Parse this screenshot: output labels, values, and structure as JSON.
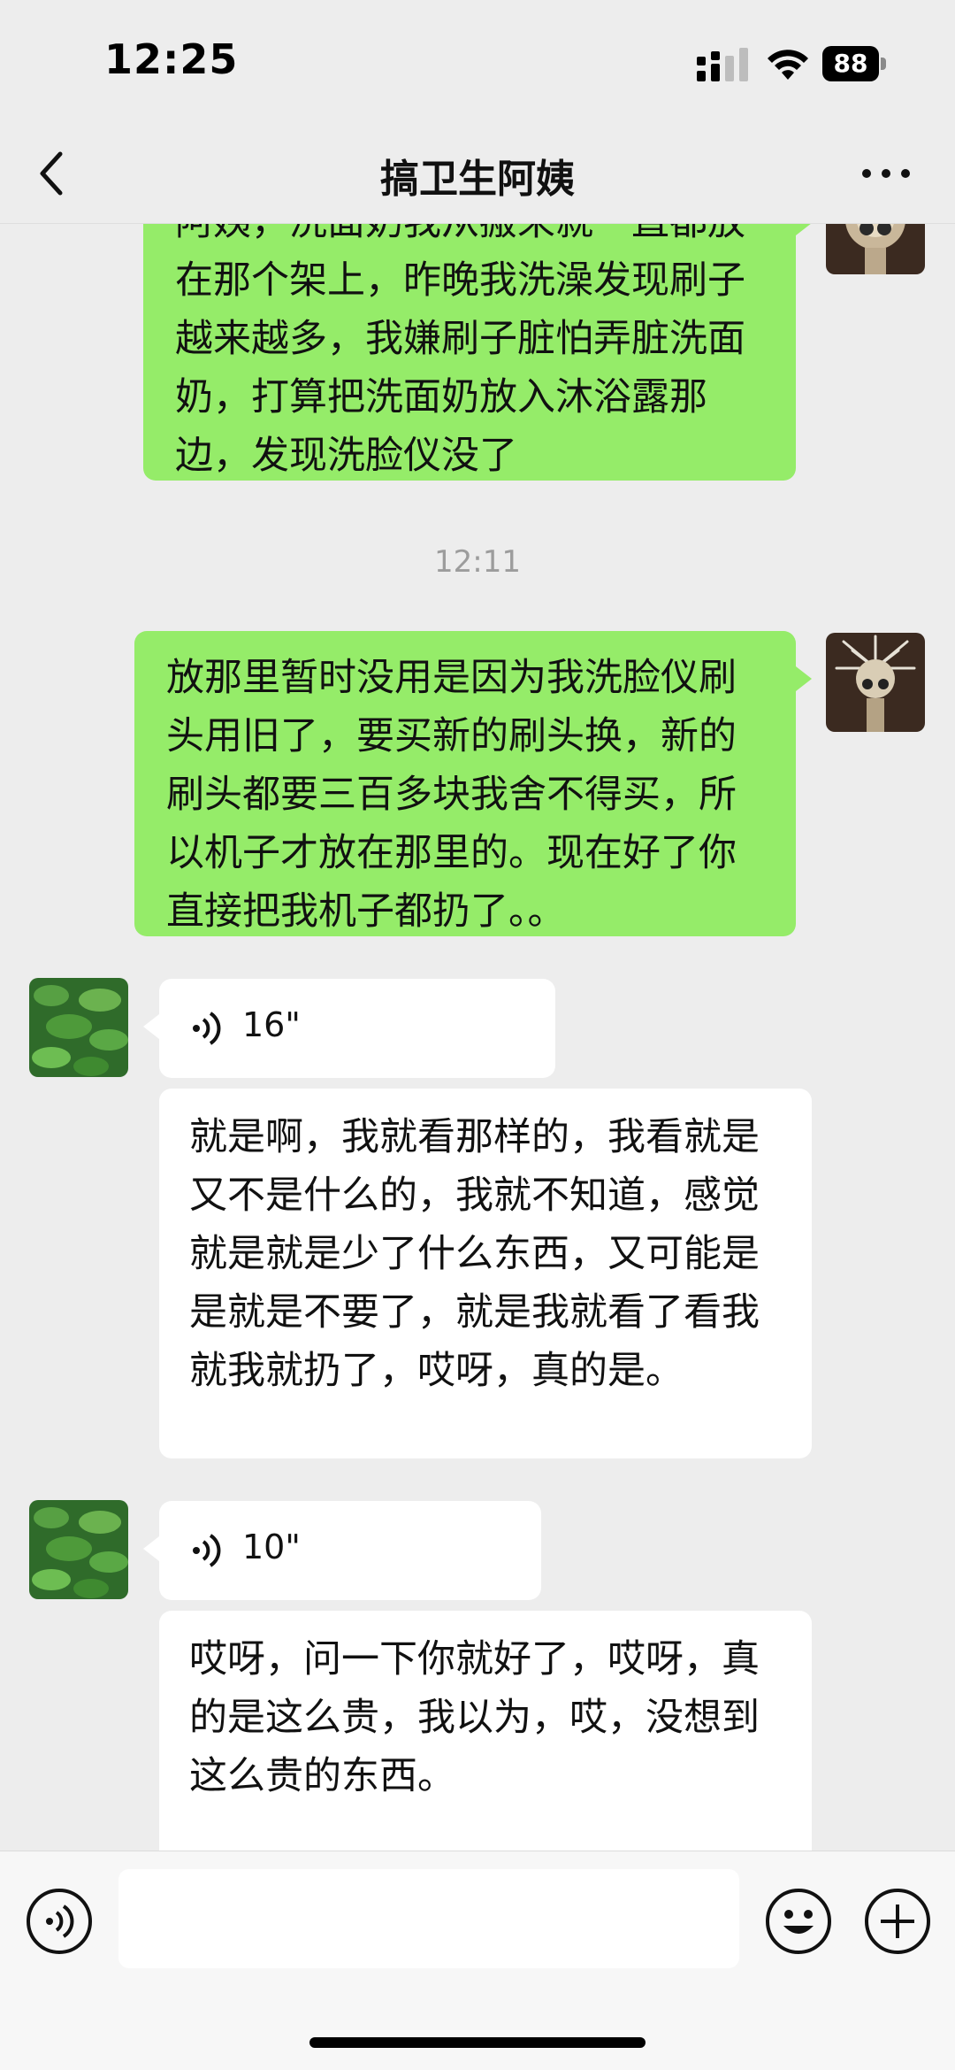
{
  "status_bar": {
    "time": "12:25",
    "battery": "88"
  },
  "header": {
    "title": "搞卫生阿姨"
  },
  "messages": {
    "m1": {
      "sender": "me",
      "text": "阿姨，洗面奶我从搬来就一直都放在那个架上，昨晚我洗澡发现刷子越来越多，我嫌刷子脏怕弄脏洗面奶，打算把洗面奶放入沐浴露那边，发现洗脸仪没了"
    },
    "ts1": "12:11",
    "m2": {
      "sender": "me",
      "text": "放那里暂时没用是因为我洗脸仪刷头用旧了，要买新的刷头换，新的刷头都要三百多块我舍不得买，所以机子才放在那里的。现在好了你直接把我机子都扔了。。"
    },
    "m3": {
      "sender": "other",
      "voice_duration": "16\"",
      "transcript": "就是啊，我就看那样的，我看就是又不是什么的，我就不知道，感觉就是就是少了什么东西，又可能是是就是不要了，就是我就看了看我就我就扔了，哎呀，真的是。"
    },
    "m4": {
      "sender": "other",
      "voice_duration": "10\"",
      "transcript": "哎呀，问一下你就好了，哎呀，真的是这么贵，我以为，哎，没想到这么贵的东西。"
    }
  },
  "colors": {
    "my_bubble": "#95ec69",
    "their_bubble": "#ffffff",
    "background": "#ededed"
  },
  "icons": [
    "back-icon",
    "more-icon",
    "voice-input-icon",
    "emoji-icon",
    "plus-icon",
    "voice-wave-icon"
  ]
}
